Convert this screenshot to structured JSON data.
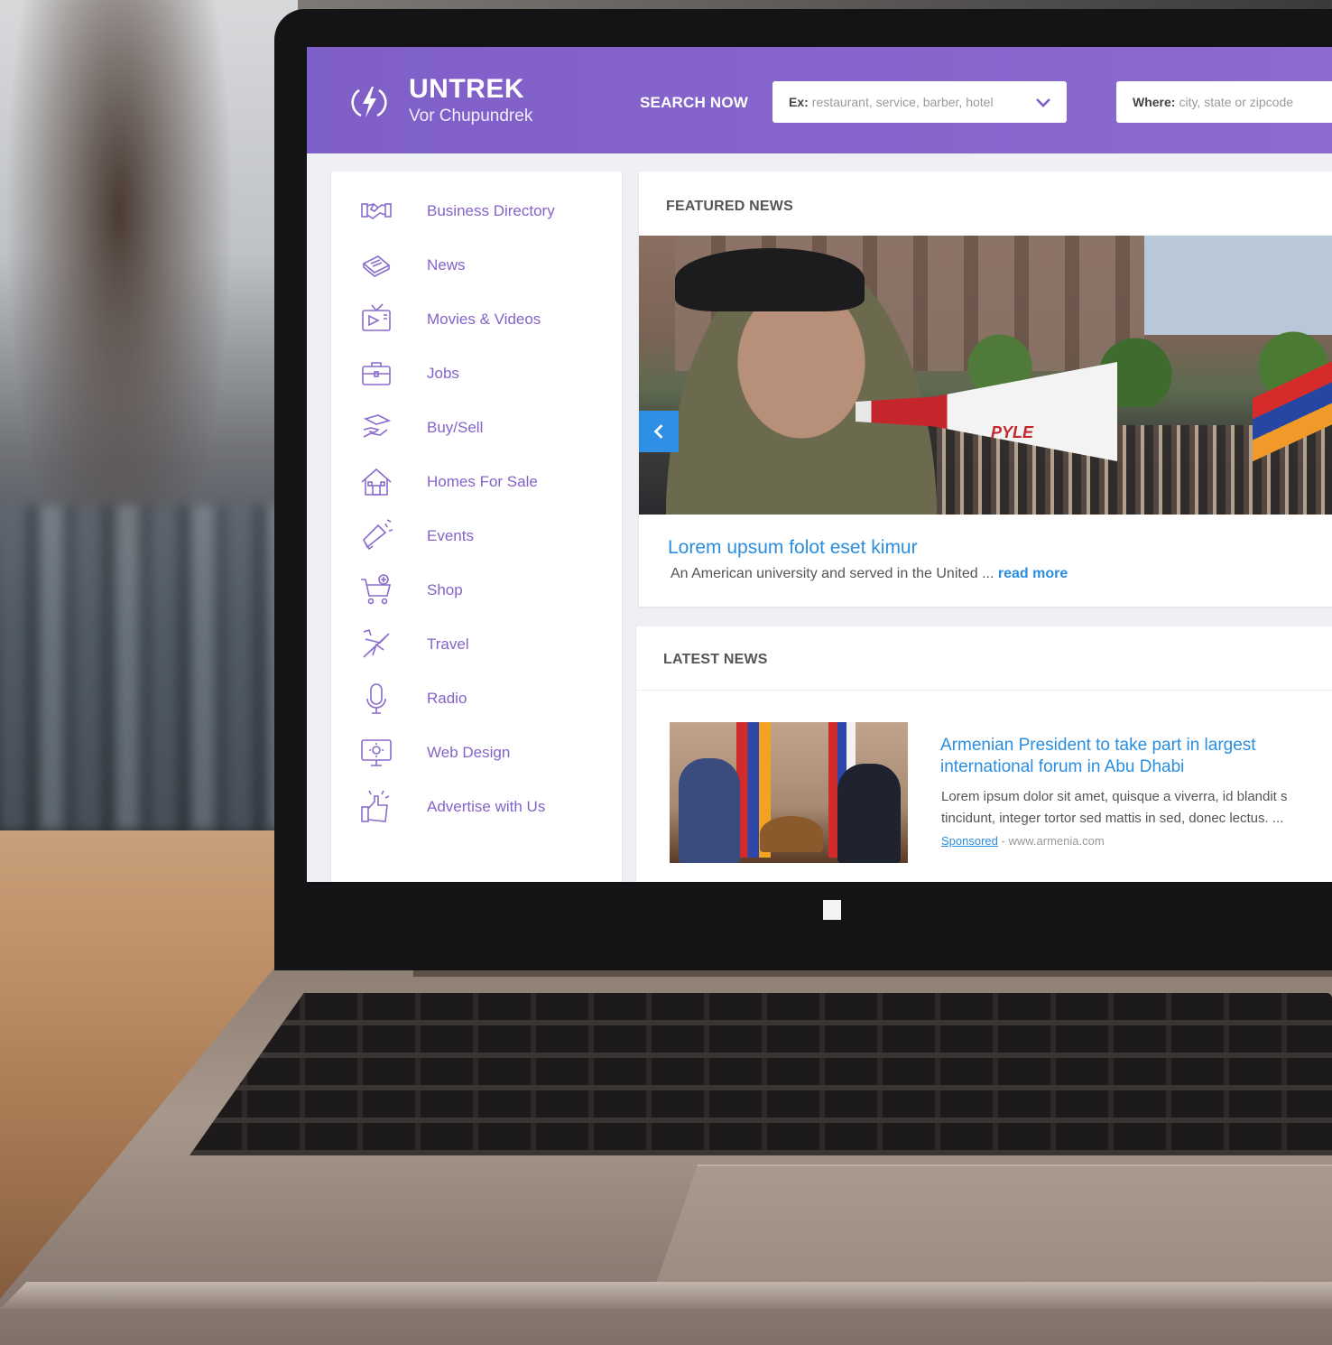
{
  "header": {
    "brand_title": "UNTREK",
    "brand_subtitle": "Vor Chupundrek",
    "search_now_label": "SEARCH NOW",
    "search_what_label": "Ex:",
    "search_what_placeholder": "restaurant, service, barber, hotel",
    "search_where_label": "Where:",
    "search_where_placeholder": "city, state or zipcode"
  },
  "sidebar": {
    "items": [
      {
        "label": "Business Directory",
        "icon": "handshake-icon"
      },
      {
        "label": "News",
        "icon": "newspaper-icon"
      },
      {
        "label": "Movies & Videos",
        "icon": "tv-icon"
      },
      {
        "label": "Jobs",
        "icon": "briefcase-icon"
      },
      {
        "label": "Buy/Sell",
        "icon": "hand-money-icon"
      },
      {
        "label": "Homes For Sale",
        "icon": "house-icon"
      },
      {
        "label": "Events",
        "icon": "megaphone-icon"
      },
      {
        "label": "Shop",
        "icon": "cart-icon"
      },
      {
        "label": "Travel",
        "icon": "airplane-icon"
      },
      {
        "label": "Radio",
        "icon": "microphone-icon"
      },
      {
        "label": "Web Design",
        "icon": "monitor-gear-icon"
      },
      {
        "label": "Advertise with Us",
        "icon": "thumbs-up-icon"
      }
    ]
  },
  "featured": {
    "title": "FEATURED NEWS",
    "headline": "Lorem upsum folot eset kimur",
    "excerpt": "An American university and served in the United ...",
    "read_more": "read more",
    "image_brand_text": "PYLE"
  },
  "latest": {
    "title": "LATEST NEWS",
    "item": {
      "headline": "Armenian President to take part in largest international forum in Abu Dhabi",
      "body_line1": "Lorem ipsum dolor sit amet, quisque a viverra, id blandit s",
      "body_line2": "tincidunt, integer tortor sed mattis in sed, donec lectus. ...",
      "sponsored_label": "Sponsored",
      "source": "- www.armenia.com"
    }
  },
  "colors": {
    "brand_purple": "#8463c9",
    "link_blue": "#2a8ee0",
    "slider_button": "#2f8fe6"
  }
}
